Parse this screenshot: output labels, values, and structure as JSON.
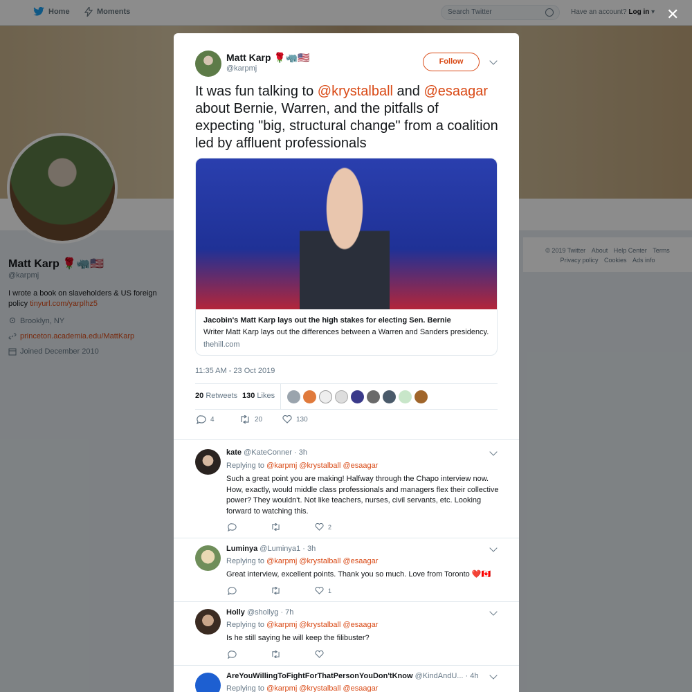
{
  "topnav": {
    "home_label": "Home",
    "moments_label": "Moments",
    "search_placeholder": "Search Twitter",
    "have_account_label": "Have an account?",
    "login_label": "Log in",
    "close_label": "✕"
  },
  "profile": {
    "name": "Matt Karp",
    "name_emoji": "🌹🦏🇺🇸",
    "handle": "@karpmj",
    "bio": "I wrote a book on slaveholders & US foreign policy",
    "bio_link": "tinyurl.com/yarplhz5",
    "location": "Brooklyn, NY",
    "website": "princeton.academia.edu/MattKarp",
    "joined": "Joined December 2010"
  },
  "footer": {
    "links": [
      "© 2019 Twitter",
      "About",
      "Help Center",
      "Terms",
      "Privacy policy",
      "Cookies",
      "Ads info"
    ]
  },
  "tweet": {
    "author_name": "Matt Karp",
    "author_emoji": "🌹🦏🇺🇸",
    "author_handle": "@karpmj",
    "follow_label": "Follow",
    "text_1": "It was fun talking to ",
    "mention_1": "@krystalball",
    "text_2": " and ",
    "mention_2": "@esaagar",
    "text_3": " about Bernie, Warren, and the pitfalls of expecting \"big, structural change\" from a coalition led by affluent professionals",
    "card_title": "Jacobin's Matt Karp lays out the high stakes for electing Sen. Bernie",
    "card_desc": "Writer Matt Karp lays out the differences between a Warren and Sanders presidency.",
    "card_domain": "thehill.com",
    "timestamp": "11:35 AM - 23 Oct 2019",
    "retweets_count": "20",
    "retweets_label": "Retweets",
    "likes_count": "130",
    "likes_label": "Likes",
    "reply_count": "4",
    "retweet_count": "20",
    "like_count": "130"
  },
  "replies": [
    {
      "name": "kate",
      "handle": "@KateConner",
      "time": "· 3h",
      "replying_label": "Replying to",
      "replying_to": "@karpmj @krystalball @esaagar",
      "text": "Such a great point you are making! Halfway through the Chapo interview now. How, exactly, would middle class professionals and managers flex their collective power? They wouldn't. Not like teachers, nurses, civil servants, etc. Looking forward to watching this.",
      "likes": "2"
    },
    {
      "name": "Luminya",
      "handle": "@Luminya1",
      "time": "· 3h",
      "replying_label": "Replying to",
      "replying_to": "@karpmj @krystalball @esaagar",
      "text": "Great interview, excellent points. Thank you so much. Love from Toronto ❤️🇨🇦",
      "likes": "1"
    },
    {
      "name": "Holly",
      "handle": "@shollyg",
      "time": "· 7h",
      "replying_label": "Replying to",
      "replying_to": "@karpmj @krystalball @esaagar",
      "text": "Is he still saying he will keep the filibuster?",
      "likes": ""
    },
    {
      "name": "AreYouWillingToFightForThatPersonYouDon'tKnow",
      "handle": "@KindAndU...",
      "time": "· 4h",
      "replying_label": "Replying to",
      "replying_to": "@karpmj @krystalball @esaagar",
      "text": "",
      "likes": ""
    }
  ],
  "colors": {
    "accent": "#d94a16",
    "twitter_blue": "#1da1f2"
  }
}
